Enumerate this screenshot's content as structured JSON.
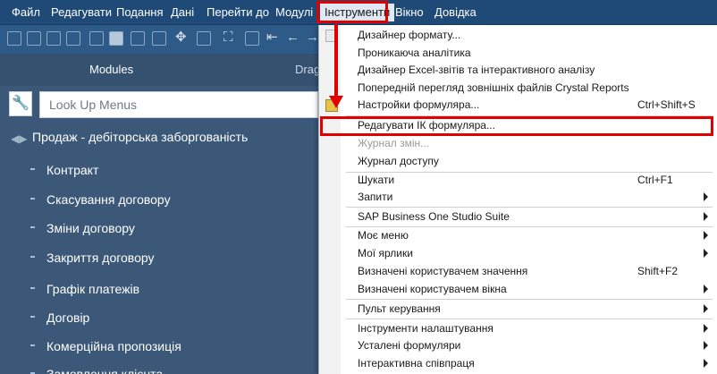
{
  "menubar": {
    "items": [
      "Файл",
      "Редагувати",
      "Подання",
      "Дані",
      "Перейти до",
      "Модулі",
      "Інструменти",
      "Вікно",
      "Довідка"
    ],
    "active": "Інструменти"
  },
  "toolbar": {
    "icons": [
      "print-preview-icon",
      "print-icon",
      "email-icon",
      "excel-export-icon",
      "word-export-icon",
      "pdf-export-icon",
      "move-icon",
      "form-settings-icon",
      "find-icon",
      "add-icon",
      "first-record-icon",
      "previous-record-icon",
      "next-record-icon"
    ]
  },
  "panel": {
    "title": "Modules",
    "drag_hint": "Drag",
    "search_placeholder": "Look Up Menus",
    "group_title": "Продаж - дебіторська заборгованість",
    "items": [
      "Контракт",
      "Скасування договору",
      "Зміни договору",
      "Закриття договору",
      "Графік платежів",
      "Договір",
      "Комерційна пропозиція",
      "Замовлення клієнта"
    ]
  },
  "dropdown": {
    "items": [
      {
        "label": "Дизайнер формату...",
        "shortcut": "",
        "submenu": false,
        "disabled": false
      },
      {
        "label": "Проникаюча аналітика",
        "shortcut": "",
        "submenu": false,
        "disabled": false
      },
      {
        "label": "Дизайнер Excel-звітів та інтерактивного аналізу",
        "shortcut": "",
        "submenu": false,
        "disabled": false
      },
      {
        "label": "Попередній перегляд зовнішніх файлів Crystal Reports",
        "shortcut": "",
        "submenu": false,
        "disabled": false
      },
      {
        "label": "Настройки формуляра...",
        "shortcut": "Ctrl+Shift+S",
        "submenu": false,
        "disabled": false
      },
      {
        "label": "Редагувати ІК формуляра...",
        "shortcut": "",
        "submenu": false,
        "disabled": false
      },
      {
        "label": "Журнал змін...",
        "shortcut": "",
        "submenu": false,
        "disabled": true
      },
      {
        "label": "Журнал доступу",
        "shortcut": "",
        "submenu": false,
        "disabled": false
      },
      {
        "label": "Шукати",
        "shortcut": "Ctrl+F1",
        "submenu": false,
        "disabled": false
      },
      {
        "label": "Запити",
        "shortcut": "",
        "submenu": true,
        "disabled": false
      },
      {
        "label": "SAP Business One Studio Suite",
        "shortcut": "",
        "submenu": true,
        "disabled": false
      },
      {
        "label": "Моє меню",
        "shortcut": "",
        "submenu": true,
        "disabled": false
      },
      {
        "label": "Мої ярлики",
        "shortcut": "",
        "submenu": true,
        "disabled": false
      },
      {
        "label": "Визначені користувачем значення",
        "shortcut": "Shift+F2",
        "submenu": false,
        "disabled": false
      },
      {
        "label": "Визначені користувачем вікна",
        "shortcut": "",
        "submenu": true,
        "disabled": false
      },
      {
        "label": "Пульт керування",
        "shortcut": "",
        "submenu": true,
        "disabled": false
      },
      {
        "label": "Інструменти налаштування",
        "shortcut": "",
        "submenu": true,
        "disabled": false
      },
      {
        "label": "Усталені формуляри",
        "shortcut": "",
        "submenu": true,
        "disabled": false
      },
      {
        "label": "Інтерактивна співпраця",
        "shortcut": "",
        "submenu": true,
        "disabled": false
      }
    ]
  },
  "colors": {
    "menubar": "#1f4a78",
    "panel": "#3b5878",
    "highlight": "#e10000"
  }
}
